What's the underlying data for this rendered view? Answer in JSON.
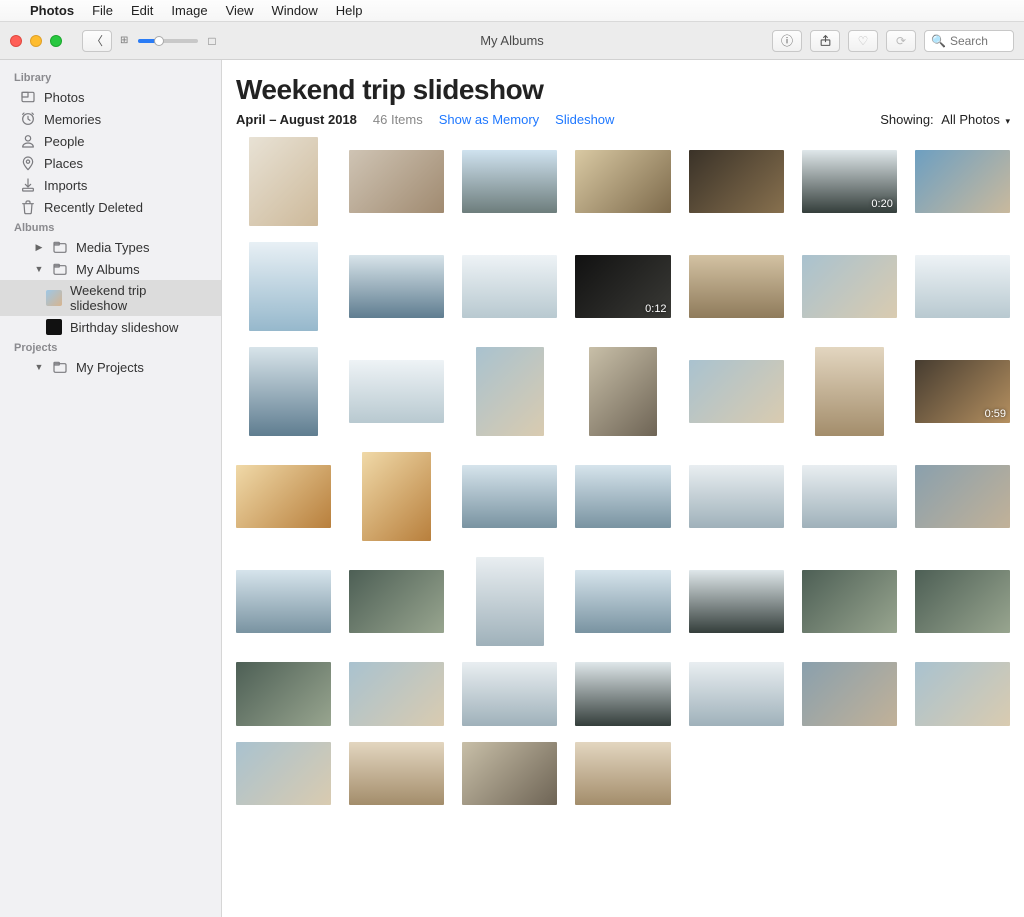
{
  "menubar": {
    "app": "Photos",
    "items": [
      "File",
      "Edit",
      "Image",
      "View",
      "Window",
      "Help"
    ]
  },
  "toolbar": {
    "window_title": "My Albums",
    "search_placeholder": "Search"
  },
  "sidebar": {
    "sections": [
      {
        "heading": "Library",
        "items": [
          {
            "label": "Photos",
            "icon": "photos"
          },
          {
            "label": "Memories",
            "icon": "memories"
          },
          {
            "label": "People",
            "icon": "people"
          },
          {
            "label": "Places",
            "icon": "places"
          },
          {
            "label": "Imports",
            "icon": "imports"
          },
          {
            "label": "Recently Deleted",
            "icon": "trash"
          }
        ]
      },
      {
        "heading": "Albums",
        "items": [
          {
            "label": "Media Types",
            "icon": "folder",
            "disclosure": "right"
          },
          {
            "label": "My Albums",
            "icon": "folder",
            "disclosure": "down",
            "children": [
              {
                "label": "Weekend trip slideshow",
                "icon": "album-color",
                "selected": true
              },
              {
                "label": "Birthday slideshow",
                "icon": "album-black"
              }
            ]
          }
        ]
      },
      {
        "heading": "Projects",
        "items": [
          {
            "label": "My Projects",
            "icon": "folder",
            "disclosure": "down"
          }
        ]
      }
    ]
  },
  "content": {
    "title": "Weekend trip slideshow",
    "date_range": "April – August 2018",
    "count_label": "46 Items",
    "show_as_memory": "Show as Memory",
    "slideshow": "Slideshow",
    "showing_label": "Showing:",
    "showing_value": "All Photos",
    "photos": [
      {
        "o": "port",
        "g": "g1"
      },
      {
        "o": "land",
        "g": "g2"
      },
      {
        "o": "land",
        "g": "g3"
      },
      {
        "o": "land",
        "g": "g4"
      },
      {
        "o": "land",
        "g": "g5"
      },
      {
        "o": "land",
        "g": "g6",
        "badge": "0:20"
      },
      {
        "o": "land",
        "g": "g7"
      },
      {
        "o": "port",
        "g": "g8"
      },
      {
        "o": "land",
        "g": "g9"
      },
      {
        "o": "land",
        "g": "g12"
      },
      {
        "o": "land",
        "g": "g10",
        "badge": "0:12"
      },
      {
        "o": "land",
        "g": "g11"
      },
      {
        "o": "land",
        "g": "g13"
      },
      {
        "o": "land",
        "g": "g12"
      },
      {
        "o": "port",
        "g": "g9"
      },
      {
        "o": "land",
        "g": "g12"
      },
      {
        "o": "port",
        "g": "g13"
      },
      {
        "o": "port",
        "g": "g16"
      },
      {
        "o": "land",
        "g": "g13"
      },
      {
        "o": "port",
        "g": "g21"
      },
      {
        "o": "land",
        "g": "g18",
        "badge": "0:59"
      },
      {
        "o": "land",
        "g": "g14"
      },
      {
        "o": "port",
        "g": "g14"
      },
      {
        "o": "land",
        "g": "g15"
      },
      {
        "o": "land",
        "g": "g15"
      },
      {
        "o": "land",
        "g": "g17"
      },
      {
        "o": "land",
        "g": "g17"
      },
      {
        "o": "land",
        "g": "g19"
      },
      {
        "o": "land",
        "g": "g15"
      },
      {
        "o": "land",
        "g": "g20"
      },
      {
        "o": "port",
        "g": "g17"
      },
      {
        "o": "land",
        "g": "g15"
      },
      {
        "o": "land",
        "g": "g6"
      },
      {
        "o": "land",
        "g": "g20"
      },
      {
        "o": "land",
        "g": "g20"
      },
      {
        "o": "land",
        "g": "g20"
      },
      {
        "o": "land",
        "g": "g13"
      },
      {
        "o": "land",
        "g": "g17"
      },
      {
        "o": "land",
        "g": "g6"
      },
      {
        "o": "land",
        "g": "g17"
      },
      {
        "o": "land",
        "g": "g19"
      },
      {
        "o": "land",
        "g": "g13"
      },
      {
        "o": "land",
        "g": "g13"
      },
      {
        "o": "land",
        "g": "g21"
      },
      {
        "o": "land",
        "g": "g16"
      },
      {
        "o": "land",
        "g": "g21"
      }
    ]
  }
}
